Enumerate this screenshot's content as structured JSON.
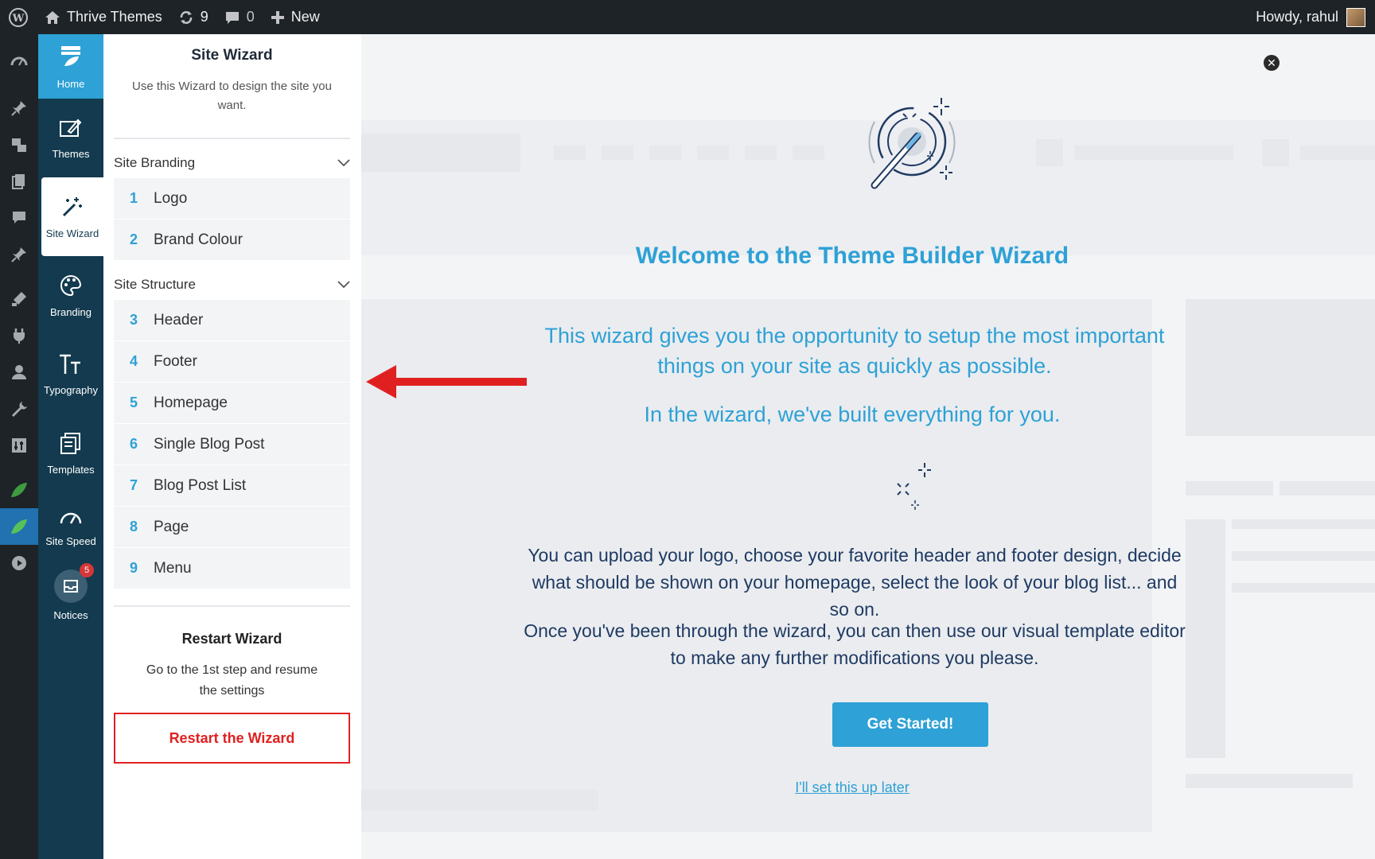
{
  "adminbar": {
    "site_name": "Thrive Themes",
    "updates_count": "9",
    "comments_count": "0",
    "new_label": "New",
    "howdy": "Howdy, rahul"
  },
  "ttnav": {
    "home": "Home",
    "themes": "Themes",
    "site_wizard": "Site Wizard",
    "branding": "Branding",
    "typography": "Typography",
    "templates": "Templates",
    "site_speed": "Site Speed",
    "notices": "Notices",
    "notices_badge": "5"
  },
  "panel": {
    "title": "Site Wizard",
    "intro": "Use this Wizard to design the site you want.",
    "branding_section": "Site Branding",
    "structure_section": "Site Structure",
    "branding_steps": [
      {
        "num": "1",
        "label": "Logo"
      },
      {
        "num": "2",
        "label": "Brand Colour"
      }
    ],
    "structure_steps": [
      {
        "num": "3",
        "label": "Header"
      },
      {
        "num": "4",
        "label": "Footer"
      },
      {
        "num": "5",
        "label": "Homepage"
      },
      {
        "num": "6",
        "label": "Single Blog Post"
      },
      {
        "num": "7",
        "label": "Blog Post List"
      },
      {
        "num": "8",
        "label": "Page"
      },
      {
        "num": "9",
        "label": "Menu"
      }
    ],
    "restart_title": "Restart Wizard",
    "restart_desc": "Go to the 1st step and resume the settings",
    "restart_button": "Restart the Wizard"
  },
  "main": {
    "title": "Welcome to the Theme Builder Wizard",
    "lead": "This wizard gives you the opportunity to setup the most important things on your site as quickly as possible.",
    "lead2": "In the wizard, we've built everything for you.",
    "para1": "You can upload your logo, choose your favorite header and footer design, decide what should be shown on your homepage, select the look of your blog list... and so on.",
    "para2": "Once you've been through the wizard, you can then use our visual template editor to make any further modifications you please.",
    "cta": "Get Started!",
    "later": "I'll set this up later"
  },
  "colors": {
    "accent": "#2ea1d6",
    "nav_bg": "#133a4e",
    "adminbar_bg": "#1d2327",
    "danger": "#e02020"
  }
}
